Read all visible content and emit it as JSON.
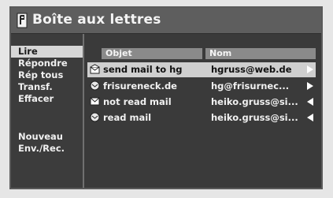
{
  "window": {
    "title": "Boîte aux lettres",
    "icon": "mailbox-icon"
  },
  "menu": {
    "items": [
      {
        "label": "Lire",
        "active": true
      },
      {
        "label": "Répondre",
        "active": false
      },
      {
        "label": "Rép tous",
        "active": false
      },
      {
        "label": "Transf.",
        "active": false
      },
      {
        "label": "Effacer",
        "active": false
      },
      {
        "label": "Nouveau",
        "active": false
      },
      {
        "label": "Env./Rec.",
        "active": false
      }
    ]
  },
  "list": {
    "columns": {
      "subject": "Objet",
      "sender": "Nom"
    },
    "rows": [
      {
        "subject": "send mail to hg",
        "sender": "hgruss@web.de",
        "icon": "envelope-open-icon",
        "direction": "outgoing",
        "selected": true
      },
      {
        "subject": "frisureneck.de",
        "sender": "hg@frisurnec...",
        "icon": "envelope-read-icon",
        "direction": "outgoing",
        "selected": false
      },
      {
        "subject": "not read mail",
        "sender": "heiko.gruss@si...",
        "icon": "envelope-unread-icon",
        "direction": "incoming",
        "selected": false
      },
      {
        "subject": "read mail",
        "sender": "heiko.gruss@si...",
        "icon": "envelope-read-icon",
        "direction": "incoming",
        "selected": false
      }
    ]
  },
  "colors": {
    "background": "#3a3a3a",
    "titlebar": "#5e5e5e",
    "header": "#8a8a8a",
    "selection": "#cfcfcf",
    "text": "#f0f0f0"
  }
}
